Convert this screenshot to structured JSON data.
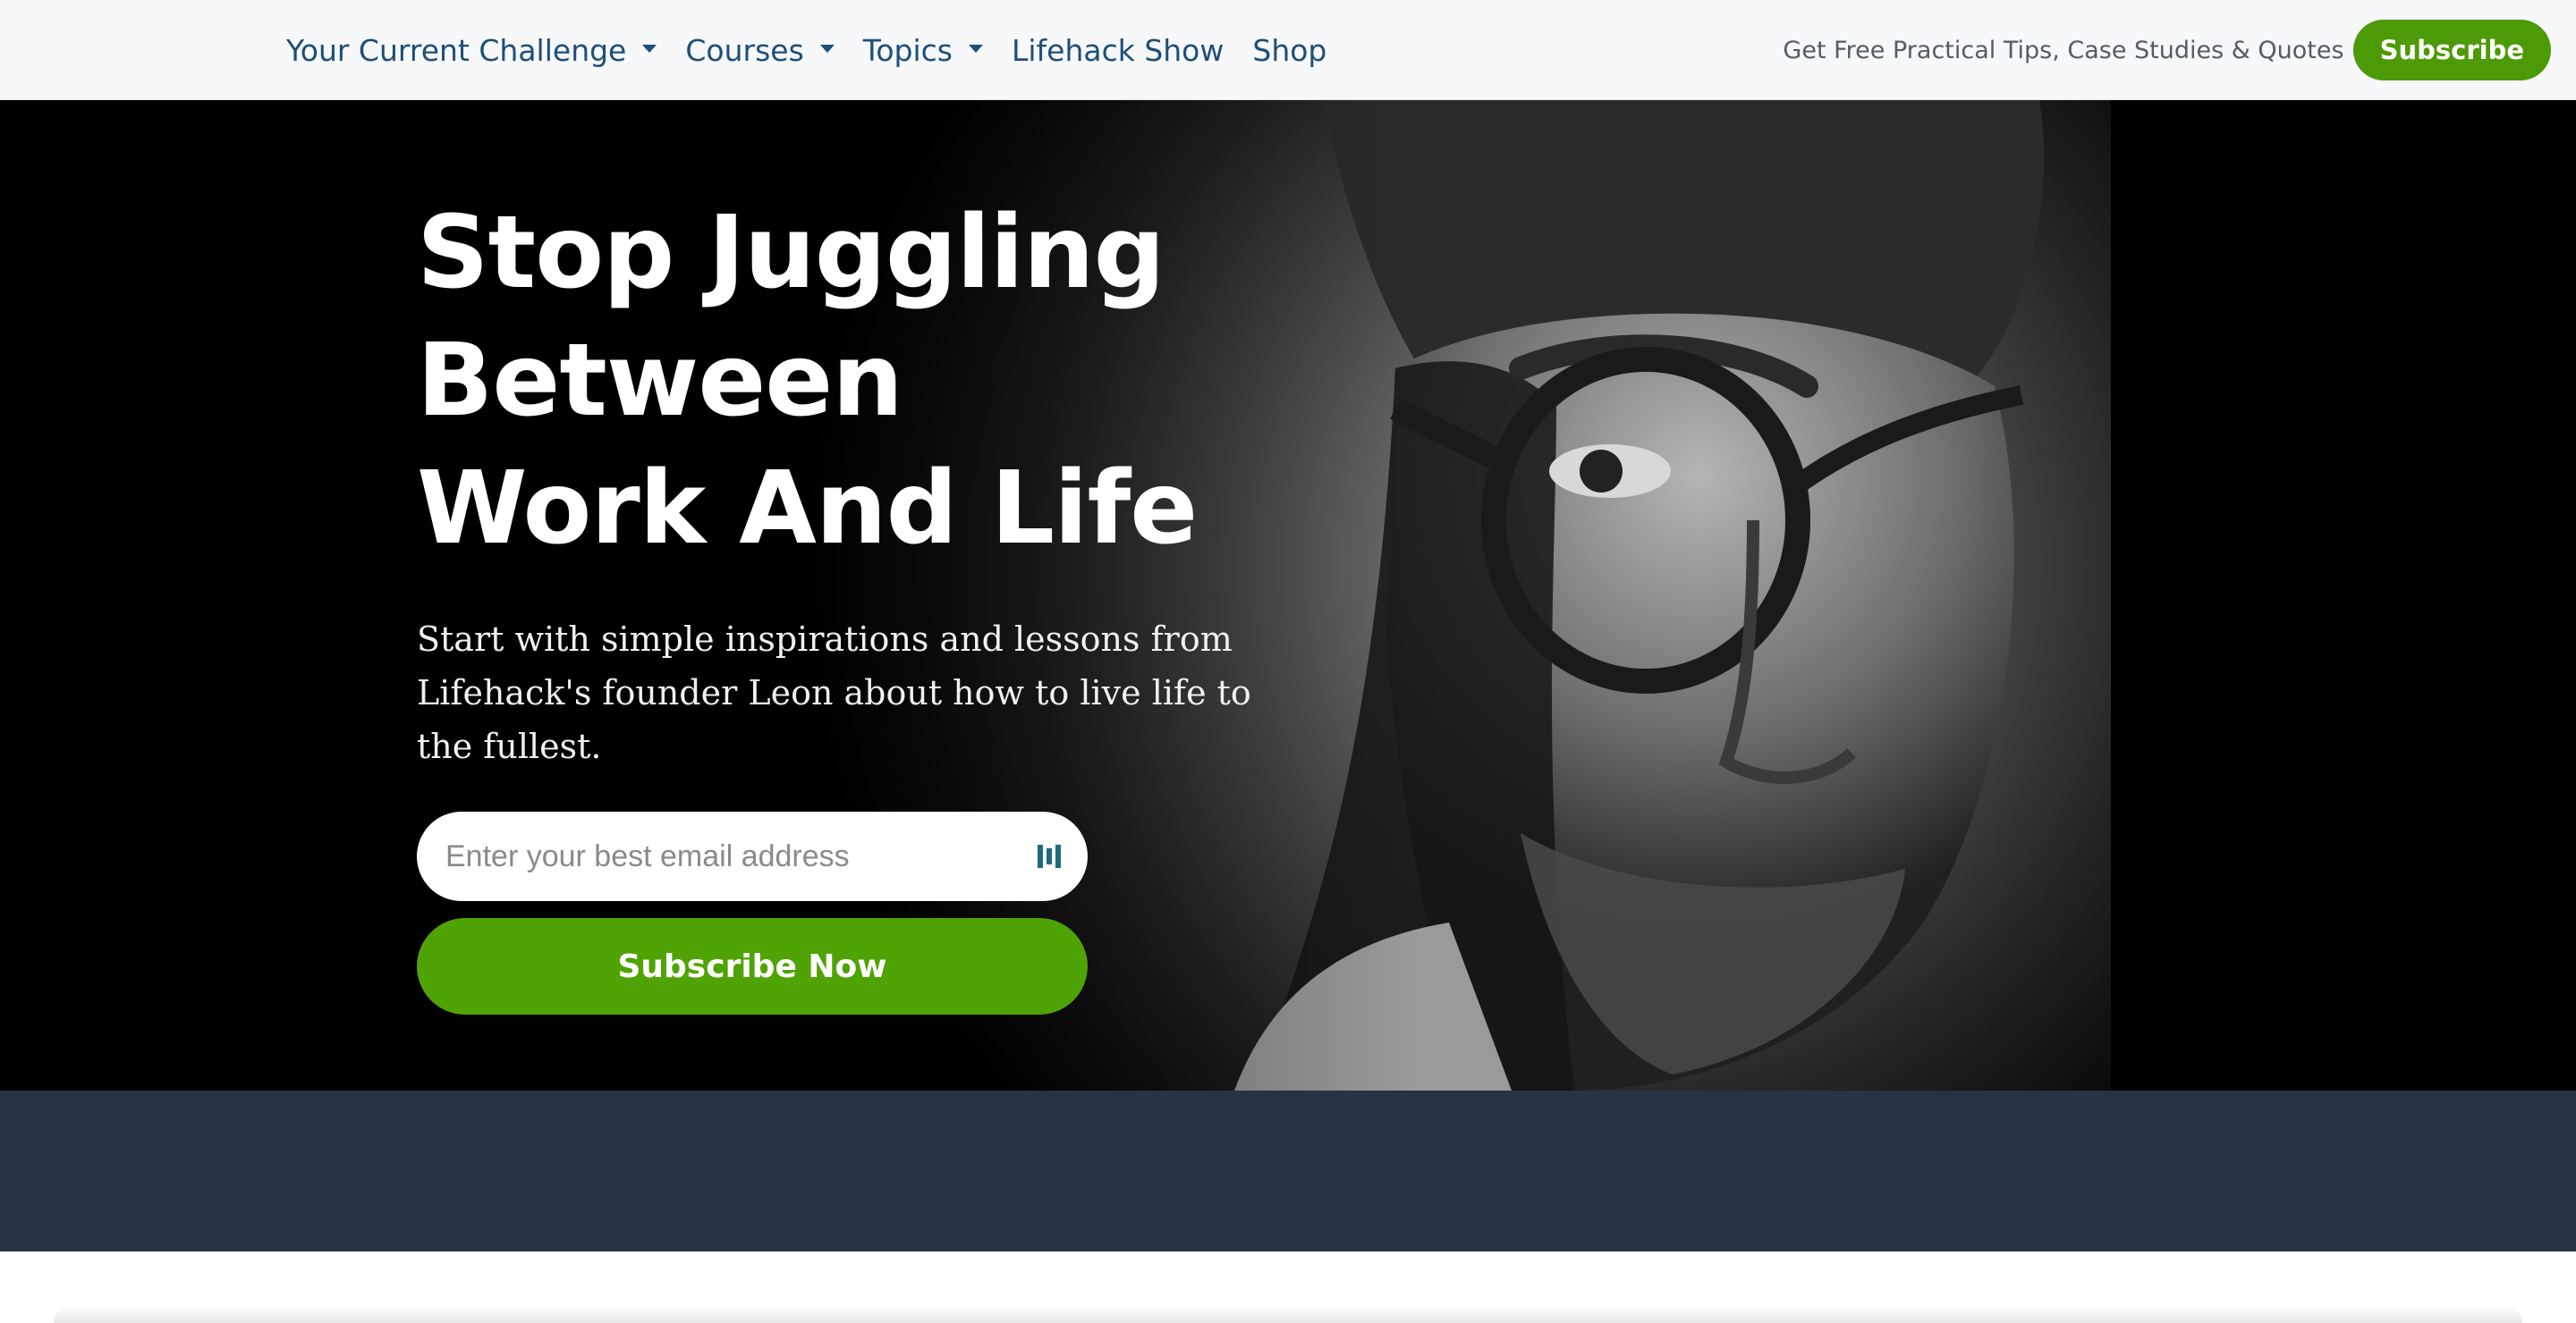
{
  "nav": {
    "items": [
      {
        "label": "Your Current Challenge",
        "has_dropdown": true
      },
      {
        "label": "Courses",
        "has_dropdown": true
      },
      {
        "label": "Topics",
        "has_dropdown": true
      },
      {
        "label": "Lifehack Show",
        "has_dropdown": false
      },
      {
        "label": "Shop",
        "has_dropdown": false
      }
    ],
    "promo_text": "Get Free Practical Tips, Case Studies & Quotes",
    "subscribe_label": "Subscribe"
  },
  "hero": {
    "title_lines": [
      "Stop Juggling",
      "Between",
      "Work And Life"
    ],
    "subtitle": "Start with simple inspirations and lessons from Lifehack's founder Leon about how to live life to the fullest.",
    "email_placeholder": "Enter your best email address",
    "email_value": "",
    "field_icon": "password-manager-icon",
    "cta_label": "Subscribe Now",
    "image": "portrait-man-glasses-bw"
  },
  "colors": {
    "nav_bg": "#f6f8fa",
    "nav_link": "#1e4e79",
    "accent_green": "#50a305",
    "hero_bg": "#000000",
    "band_bg": "#283342"
  }
}
